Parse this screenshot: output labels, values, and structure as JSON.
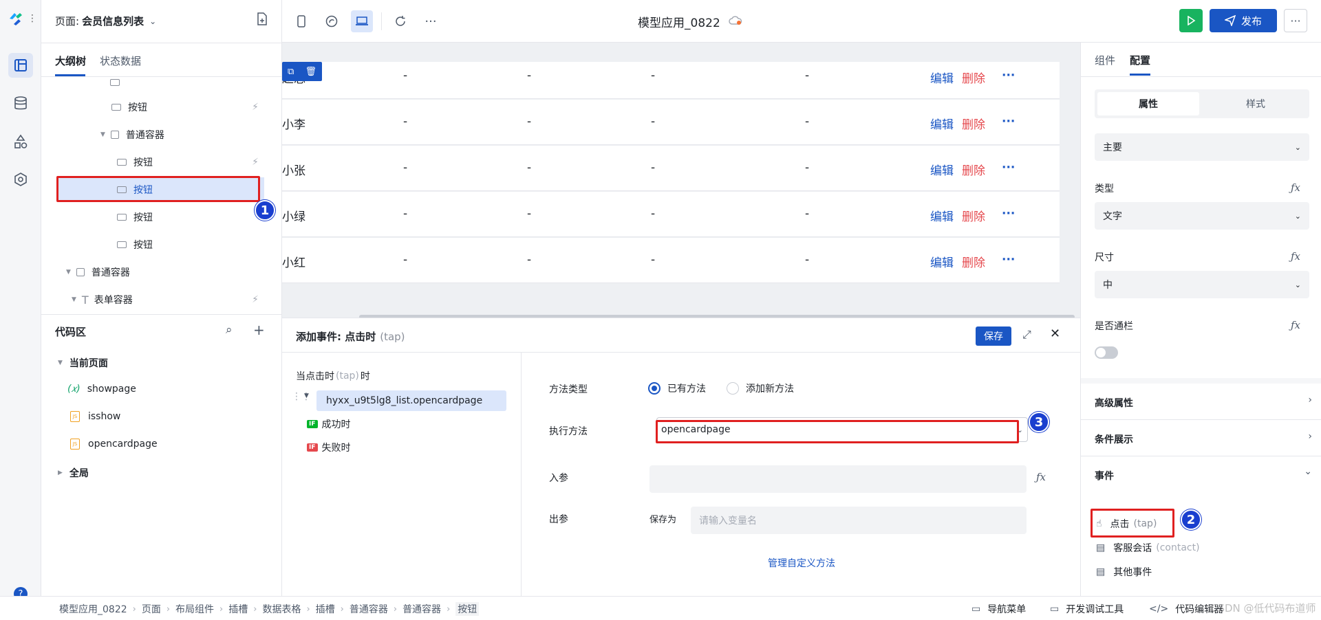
{
  "header": {
    "page_prefix": "页面:",
    "page_name": "会员信息列表",
    "app_title": "模型应用_0822",
    "publish_label": "发布"
  },
  "left": {
    "tabs": [
      "大纲树",
      "状态数据"
    ],
    "tree": [
      {
        "label": "按钮"
      },
      {
        "label": "普通容器"
      },
      {
        "label": "按钮"
      },
      {
        "label": "按钮"
      },
      {
        "label": "按钮"
      },
      {
        "label": "按钮"
      },
      {
        "label": "普通容器"
      },
      {
        "label": "表单容器"
      }
    ],
    "code_title": "代码区",
    "current_page": "当前页面",
    "code_items": [
      {
        "label": "showpage",
        "icon": "variable-icon"
      },
      {
        "label": "isshow",
        "icon": "js-file-icon"
      },
      {
        "label": "opencardpage",
        "icon": "js-file-icon"
      }
    ],
    "global": "全局"
  },
  "table": {
    "rows": [
      {
        "name": "赵总"
      },
      {
        "name": "小李"
      },
      {
        "name": "小张"
      },
      {
        "name": "小绿"
      },
      {
        "name": "小红"
      }
    ],
    "dash": "-",
    "edit": "编辑",
    "delete": "删除",
    "more": "···"
  },
  "event": {
    "title": "添加事件: 点击时",
    "title_tap": "(tap)",
    "save": "保存",
    "when_prefix": "当点击时",
    "when_tap": "(tap)",
    "when_suffix": "时",
    "action": "hyxx_u9t5lg8_list.opencardpage",
    "success": "成功时",
    "fail": "失败时",
    "if_label": "IF",
    "method_type_label": "方法类型",
    "radio_existing": "已有方法",
    "radio_new": "添加新方法",
    "exec_label": "执行方法",
    "exec_value": "opencardpage",
    "in_label": "入参",
    "out_label": "出参",
    "save_as": "保存为",
    "var_placeholder": "请输入变量名",
    "manage": "管理自定义方法"
  },
  "right": {
    "tabs": [
      "组件",
      "配置"
    ],
    "seg": [
      "属性",
      "样式"
    ],
    "primary": "主要",
    "type_label": "类型",
    "type_value": "文字",
    "size_label": "尺寸",
    "size_value": "中",
    "block_label": "是否通栏",
    "adv": "高级属性",
    "cond": "条件展示",
    "events": "事件",
    "ev_click": "点击",
    "ev_click_tap": "(tap)",
    "ev_contact": "客服会话",
    "ev_contact_tap": "(contact)",
    "ev_other": "其他事件"
  },
  "breadcrumb": [
    "模型应用_0822",
    "页面",
    "布局组件",
    "插槽",
    "数据表格",
    "插槽",
    "普通容器",
    "普通容器",
    "按钮"
  ],
  "footer": {
    "nav": "导航菜单",
    "dev": "开发调试工具",
    "code": "代码编辑器",
    "watermark": "CSDN @低代码布道师"
  },
  "badges": [
    "1",
    "2",
    "3"
  ],
  "colors": {
    "accent": "#1a56c4",
    "success": "#00b42a",
    "danger": "#e5484d",
    "marker": "#e02020"
  }
}
